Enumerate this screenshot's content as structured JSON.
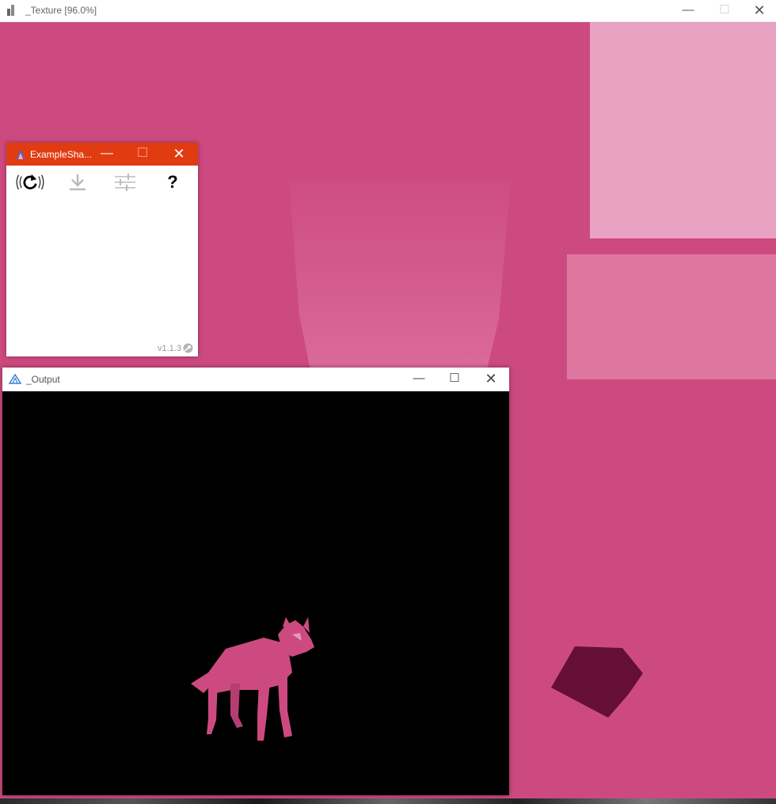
{
  "texture_window": {
    "title": "_Texture [96.0%]",
    "controls": {
      "minimize": "—",
      "maximize": "☐",
      "close": "✕"
    },
    "colors": {
      "background": "#cd4a80",
      "panel_light": "#e8a2c2",
      "panel_mid": "#dd77a0",
      "rock": "#660f36"
    }
  },
  "shader_window": {
    "title": "ExampleSha...",
    "controls": {
      "minimize": "—",
      "maximize": "☐",
      "close": "✕"
    },
    "toolbar": [
      {
        "icon": "reload-icon"
      },
      {
        "icon": "download-icon"
      },
      {
        "icon": "sliders-icon"
      },
      {
        "icon": "help-icon",
        "label": "?"
      }
    ],
    "version": "v1.1.3",
    "accent": "#e13b12"
  },
  "output_window": {
    "title": "_Output",
    "controls": {
      "minimize": "—",
      "maximize": "☐",
      "close": "✕"
    },
    "model_color": "#cd4a80"
  }
}
